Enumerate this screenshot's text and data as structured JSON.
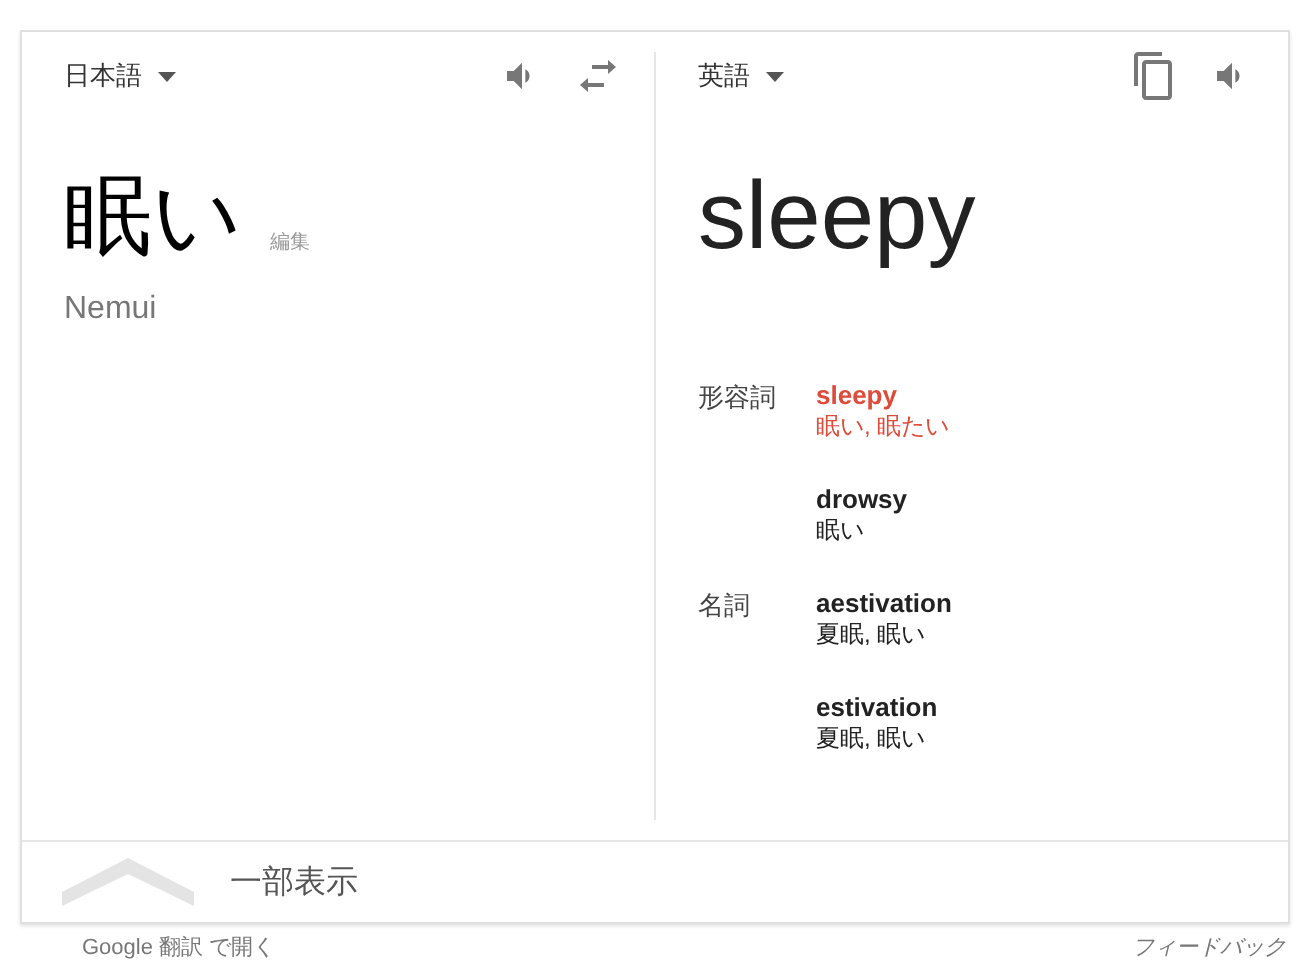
{
  "source": {
    "language": "日本語",
    "text": "眠い",
    "edit_label": "編集",
    "romanization": "Nemui"
  },
  "target": {
    "language": "英語",
    "text": "sleepy"
  },
  "dictionary": [
    {
      "part_of_speech": "形容詞",
      "entries": [
        {
          "word": "sleepy",
          "translations": "眠い, 眠たい",
          "selected": true
        },
        {
          "word": "drowsy",
          "translations": "眠い",
          "selected": false
        }
      ]
    },
    {
      "part_of_speech": "名詞",
      "entries": [
        {
          "word": "aestivation",
          "translations": "夏眠, 眠い",
          "selected": false
        },
        {
          "word": "estivation",
          "translations": "夏眠, 眠い",
          "selected": false
        }
      ]
    }
  ],
  "collapse": {
    "label": "一部表示"
  },
  "footer": {
    "open_link": "Google 翻訳 で開く",
    "feedback": "フィードバック"
  }
}
